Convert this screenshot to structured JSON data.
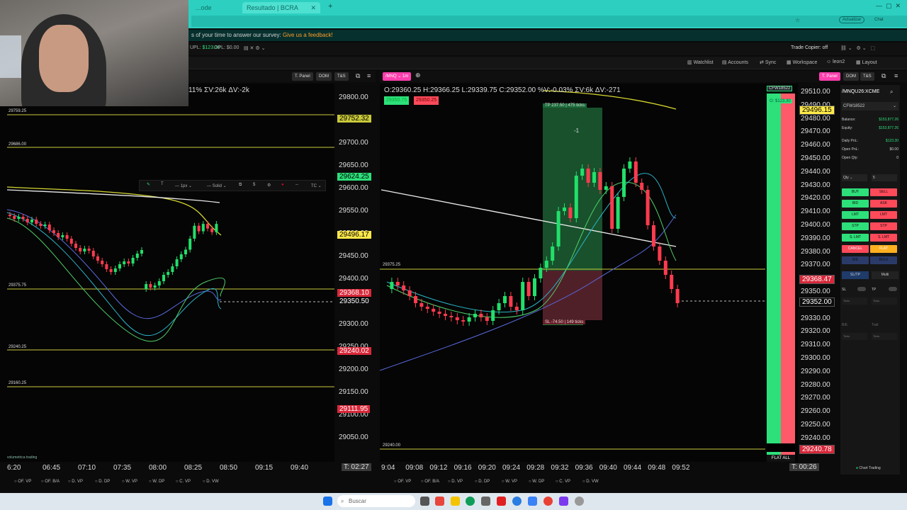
{
  "browser": {
    "tabs": [
      "...ode",
      "Resultado | BCRA"
    ],
    "actualizar": "Actualizar",
    "chat": "Chat"
  },
  "survey": {
    "text": "s of your time to answer our survey:",
    "link": "Give us a feedback!"
  },
  "account_strip": {
    "upl_label": "UPL:",
    "upl_value": "$123.30",
    "opl_label": "OPL:",
    "opl_value": "$0.00",
    "trade_copier": "Trade Copier: off"
  },
  "top_menu": {
    "watchlist": "Watchlist",
    "accounts": "Accounts",
    "sync": "Sync",
    "workspace": "Workspace",
    "user": "leon2",
    "layout": "Layout"
  },
  "left_chart": {
    "tpanel": "T. Panel",
    "dom": "DOM",
    "ts": "T&S",
    "stats": "11% ΣV:26k ΔV:-2k",
    "draw_toolbar": {
      "px": "1px",
      "style": "Solid",
      "tc": "TC"
    },
    "levels": [
      "29759.25",
      "29686.00",
      "29375.75",
      "29240.25",
      "29160.25"
    ],
    "price_ticks": [
      "29800.00",
      "29750.00",
      "29700.00",
      "29650.00",
      "29600.00",
      "29550.00",
      "29500.00",
      "29450.00",
      "29400.00",
      "29350.00",
      "29300.00",
      "29250.00",
      "29200.00",
      "29150.00",
      "29100.00",
      "29050.00"
    ],
    "price_labels": {
      "green_1": "29752.32",
      "green_2": "29624.25",
      "yellow": "29496.17",
      "red_1": "29368.10",
      "current": "29350.50",
      "red_2": "29240.02",
      "red_3": "29111.95"
    },
    "time_ticks": [
      "6:20",
      "06:45",
      "07:10",
      "07:35",
      "08:00",
      "08:25",
      "08:50",
      "09:15",
      "09:40"
    ],
    "timer": "T: 02:27",
    "indicators": [
      "OF. VP",
      "OF. B/A",
      "D. VP",
      "D. DP",
      "W. VP",
      "W. DP",
      "C. VP",
      "D. VW"
    ],
    "brand": "volumetrica trading"
  },
  "right_chart": {
    "symbol": "/MNQ",
    "interval": "1m",
    "tpanel": "T. Panel",
    "dom": "DOM",
    "ts": "T&S",
    "ohlc": "O:29360.25 H:29366.25 L:29339.75 C:29352.00 %V:-0.03% ΣV:6k ΔV:-271",
    "buy_price": "29350.75",
    "sell_price": "29350.25",
    "tp_label": "TP 237.50 | 475 ticks",
    "sl_label": "SL -74.50 | 149 ticks",
    "entry_label": "BUY +1 | R/R: 3.19",
    "pos_marker": "-1",
    "level_left": "29375.25",
    "level_bottom": "29240.00",
    "account_tag": "CFW18522",
    "account_pnl": "O: $123.30",
    "price_ticks": [
      "29510.00",
      "29490.00",
      "29480.00",
      "29470.00",
      "29460.00",
      "29450.00",
      "29440.00",
      "29430.00",
      "29420.00",
      "29410.00",
      "29400.00",
      "29390.00",
      "29380.00",
      "29370.00",
      "29360.00",
      "29350.00",
      "29340.00",
      "29330.00",
      "29320.00",
      "29310.00",
      "29300.00",
      "29290.00",
      "29280.00",
      "29270.00",
      "29260.00",
      "29250.00",
      "29240.00"
    ],
    "price_labels": {
      "yellow": "29496.15",
      "red_1": "29368.47",
      "current": "29352.00",
      "red_2": "29240.78"
    },
    "time_ticks": [
      "9:04",
      "09:08",
      "09:12",
      "09:16",
      "09:20",
      "09:24",
      "09:28",
      "09:32",
      "09:36",
      "09:40",
      "09:44",
      "09:48",
      "09:52"
    ],
    "timer": "T: 00:26",
    "flat_all": "FLAT ALL",
    "indicators": [
      "OF. VP",
      "OF. B/A",
      "D. VP",
      "D. DP",
      "W. VP",
      "W. DP",
      "C. VP",
      "D. VW"
    ],
    "brand": "volumetrica trading"
  },
  "trade_panel": {
    "tpanel": "T. Panel",
    "dom": "DOM",
    "ts": "T&S",
    "symbol": "/MNQU26:XCME",
    "account": "CFW18522",
    "balance_label": "Balance:",
    "balance": "$153,877.26",
    "equity_label": "Equity:",
    "equity": "$153,877.26",
    "daily_pnl_label": "Daily PnL:",
    "daily_pnl": "$123.30",
    "open_pnl_label": "Open PnL:",
    "open_pnl": "$0.00",
    "open_qty_label": "Open Qty:",
    "open_qty": "0",
    "qty_label": "Qty",
    "qty_value": "5",
    "buttons": [
      "BUY",
      "SELL",
      "BID",
      "ASK",
      "LMT",
      "LMT",
      "STP",
      "STP",
      "S. LMT",
      "S. LMT",
      "CANCEL",
      "FLAT",
      "B/E",
      "BULK"
    ],
    "sltp": "SL/TP",
    "multi": "Multi",
    "sl": "SL",
    "tp": "TP",
    "ticks": "Ticks",
    "be": "B/E",
    "trail": "Trail",
    "brand": "Chart Trading"
  },
  "taskbar": {
    "search_placeholder": "Buscar"
  },
  "colors": {
    "accent": "#2dd0c0",
    "bull": "#22e06a",
    "bear": "#ff3b4e",
    "level": "#c9c93a",
    "pink": "#ff3fae"
  }
}
